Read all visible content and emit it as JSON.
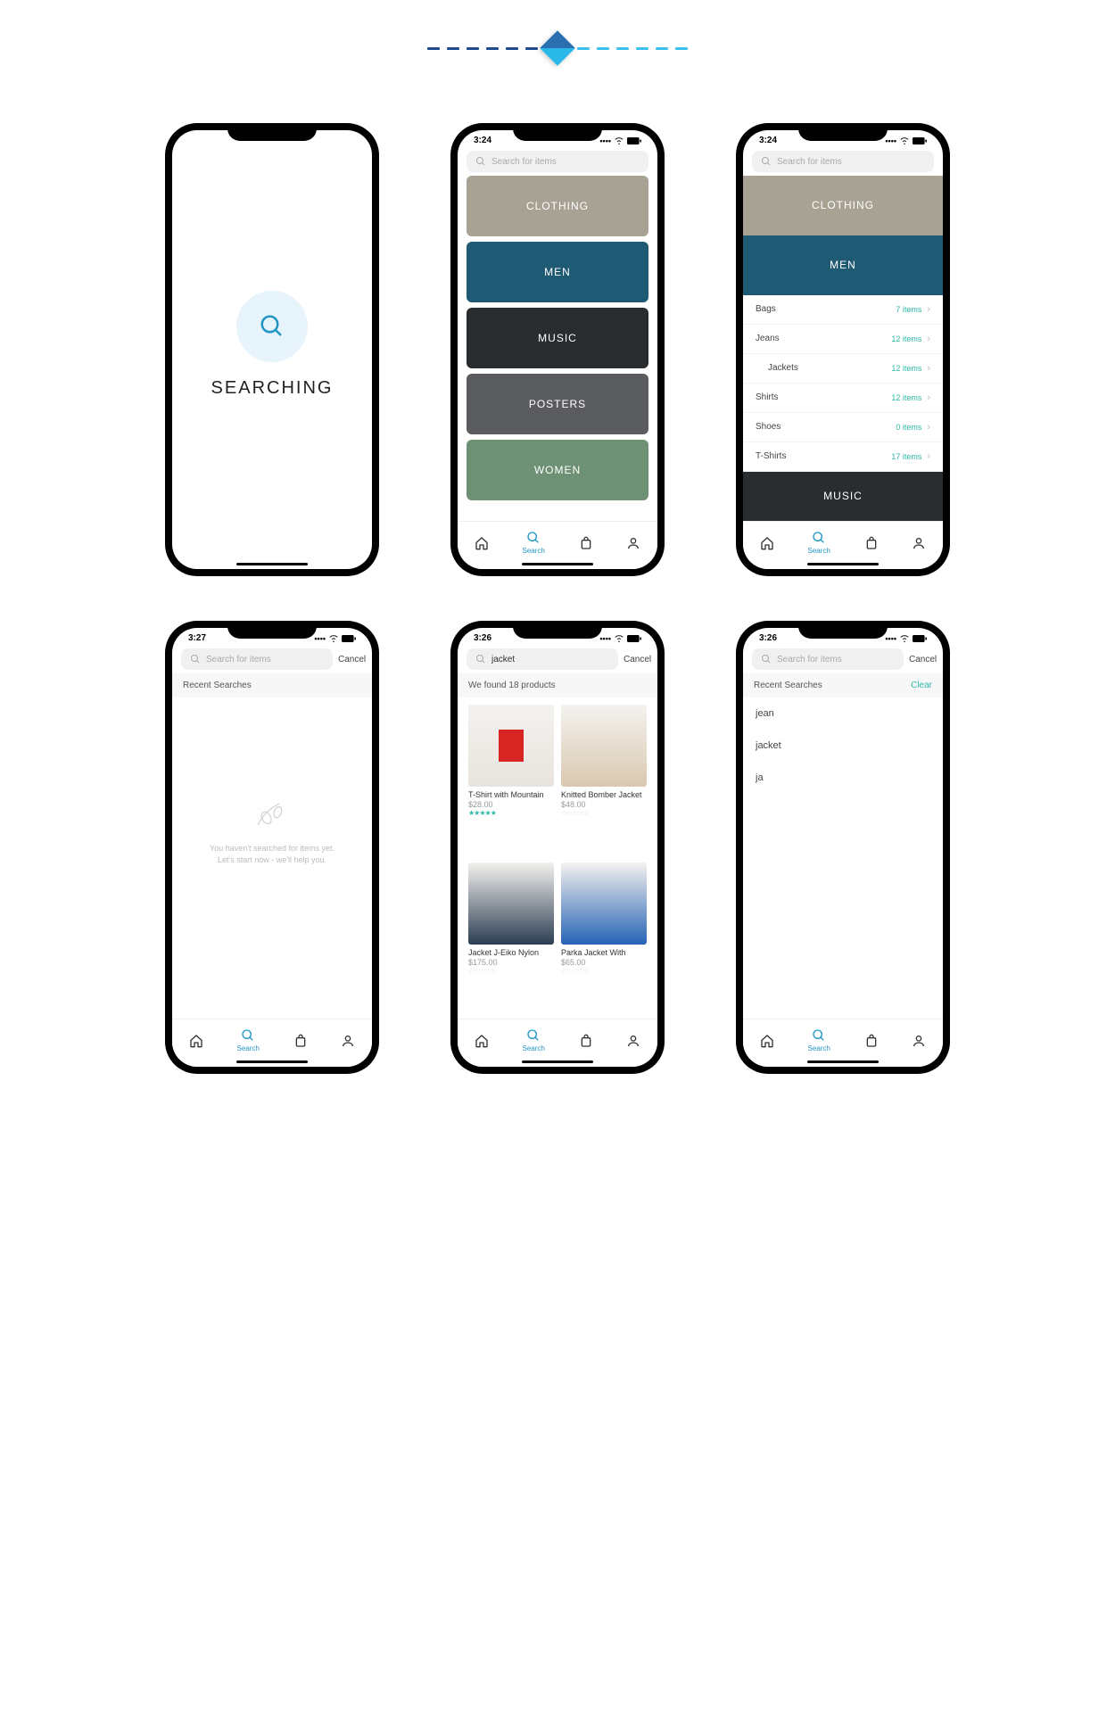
{
  "divider": {
    "left_color": "#1f4b8e",
    "right_color": "#3cc0ef"
  },
  "status": {
    "time1": "3:24",
    "time2": "3:27",
    "time3": "3:26"
  },
  "search": {
    "placeholder": "Search for items",
    "cancel": "Cancel",
    "jacket_value": "jacket"
  },
  "searching": {
    "title": "SEARCHING"
  },
  "categories": [
    "CLOTHING",
    "MEN",
    "MUSIC",
    "POSTERS",
    "WOMEN"
  ],
  "category_colors": [
    "#a8a295",
    "#1e5a73",
    "#2a2d30",
    "#5a5c5f",
    "#6e9074"
  ],
  "subcats": [
    {
      "name": "Bags",
      "count": "7 items"
    },
    {
      "name": "Jeans",
      "count": "12 items"
    },
    {
      "name": "Jackets",
      "count": "12 items",
      "indent": true
    },
    {
      "name": "Shirts",
      "count": "12 items"
    },
    {
      "name": "Shoes",
      "count": "0 items"
    },
    {
      "name": "T-Shirts",
      "count": "17 items"
    }
  ],
  "tabs": {
    "search_label": "Search"
  },
  "recent": {
    "title": "Recent Searches",
    "clear": "Clear"
  },
  "empty": {
    "line1": "You haven't searched for items yet.",
    "line2": "Let's start now - we'll help you."
  },
  "results": {
    "header": "We found 18 products"
  },
  "products": [
    {
      "title": "T-Shirt with Mountain",
      "price": "$28.00",
      "stars_on": 5,
      "img": "#e8e3de",
      "accent": "#d92424"
    },
    {
      "title": "Knitted Bomber Jacket",
      "price": "$48.00",
      "stars_on": 0,
      "img": "#d9c8b0"
    },
    {
      "title": "Jacket J-Eiko Nylon",
      "price": "$175.00",
      "stars_on": 0,
      "img": "#2b3d52"
    },
    {
      "title": "Parka Jacket With",
      "price": "$65.00",
      "stars_on": 0,
      "img": "#2563b5"
    }
  ],
  "recent_items": [
    "jean",
    "jacket",
    "ja"
  ]
}
